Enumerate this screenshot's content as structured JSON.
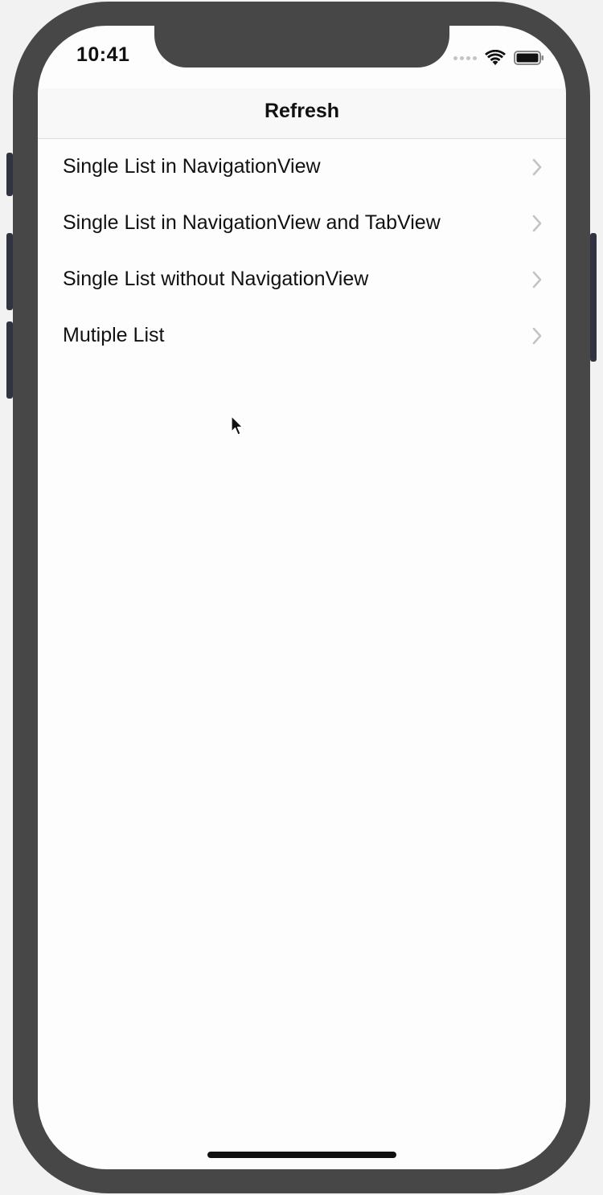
{
  "status_bar": {
    "time": "10:41"
  },
  "nav": {
    "title": "Refresh"
  },
  "list": {
    "items": [
      {
        "label": "Single List in NavigationView"
      },
      {
        "label": "Single List in NavigationView and TabView"
      },
      {
        "label": "Single List without NavigationView"
      },
      {
        "label": "Mutiple List"
      }
    ]
  },
  "icons": {
    "status": [
      "cellular-signal-icon",
      "wifi-icon",
      "battery-icon"
    ],
    "row_accessory": "chevron-right-icon",
    "pointer": "mouse-cursor-icon"
  },
  "colors": {
    "device_frame": "#474747",
    "screen_background": "#fdfdfd",
    "navbar_background": "#f8f8f8",
    "chevron": "#c4c4c7",
    "text": "#111111"
  }
}
